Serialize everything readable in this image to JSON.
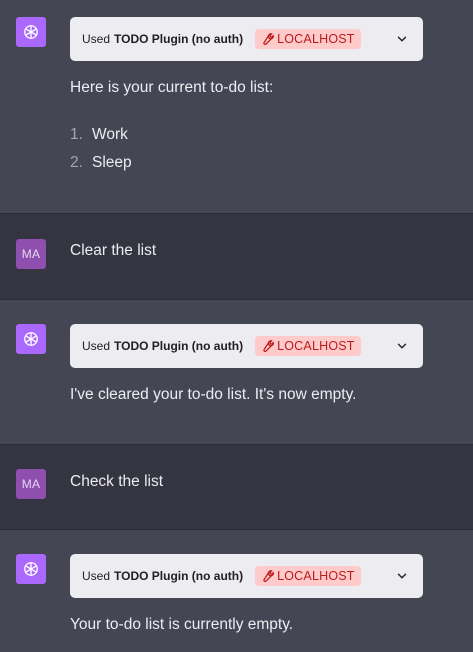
{
  "colors": {
    "assistant_bg": "#444654",
    "user_bg": "#343541",
    "gpt_avatar": "#ab68ff",
    "user_avatar": "#8e4fae",
    "badge_bg": "#fecaca",
    "badge_text": "#b91c1c"
  },
  "messages": [
    {
      "role": "assistant",
      "plugin": {
        "used": "Used",
        "name": "TODO Plugin (no auth)",
        "badge": "LOCALHOST"
      },
      "text": "Here is your current to-do list:",
      "list": [
        {
          "num": "1.",
          "text": "Work"
        },
        {
          "num": "2.",
          "text": "Sleep"
        }
      ]
    },
    {
      "role": "user",
      "avatar": "MA",
      "text": "Clear the list"
    },
    {
      "role": "assistant",
      "plugin": {
        "used": "Used",
        "name": "TODO Plugin (no auth)",
        "badge": "LOCALHOST"
      },
      "text": "I've cleared your to-do list. It's now empty."
    },
    {
      "role": "user",
      "avatar": "MA",
      "text": "Check the list"
    },
    {
      "role": "assistant",
      "plugin": {
        "used": "Used",
        "name": "TODO Plugin (no auth)",
        "badge": "LOCALHOST"
      },
      "text": "Your to-do list is currently empty."
    }
  ]
}
